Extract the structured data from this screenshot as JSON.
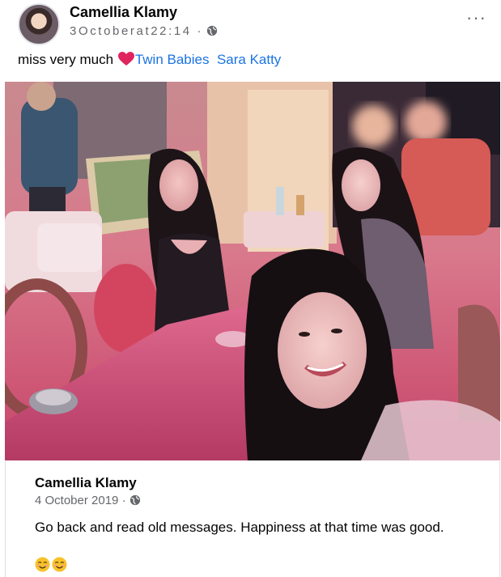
{
  "post": {
    "author": "Camellia Klamy",
    "timestamp": "3Octoberat22:14",
    "separator": "·",
    "privacy_icon": "globe-icon",
    "more_label": "···",
    "caption_text": "miss very much",
    "caption_emoji": "red-heart",
    "tags": [
      "Twin Babies",
      "Sara Katty"
    ]
  },
  "shared_post": {
    "author": "Camellia Klamy",
    "date": "4 October 2019",
    "separator": "·",
    "privacy_icon": "globe-icon",
    "text": "Go back and read old messages. Happiness at that time was good.",
    "emojis": [
      "smiling-face-with-smiling-eyes",
      "smiling-face-with-smiling-eyes"
    ]
  },
  "colors": {
    "link": "#1b74e4",
    "secondary_text": "#65676b",
    "heart": "#e0245e"
  }
}
